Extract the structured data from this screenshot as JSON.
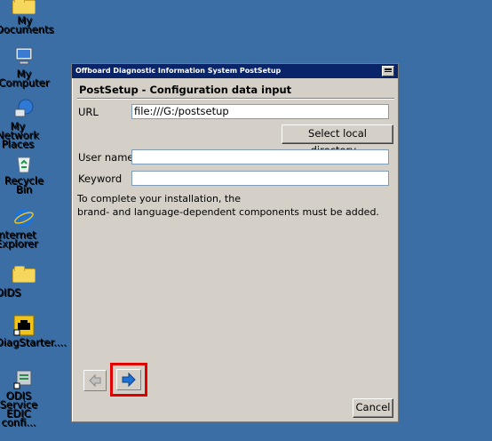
{
  "desktop": {
    "icons": [
      {
        "label": "My Documents",
        "icon": "folder-icon"
      },
      {
        "label": "My Computer",
        "icon": "computer-icon"
      },
      {
        "label": "My Network Places",
        "icon": "network-icon"
      },
      {
        "label": "Recycle Bin",
        "icon": "recycle-bin-icon"
      },
      {
        "label": "Internet Explorer",
        "icon": "internet-explorer-icon"
      },
      {
        "label": "OIDS",
        "icon": "folder-icon"
      },
      {
        "label": "DiagStarter....",
        "icon": "diagstarter-icon"
      },
      {
        "label": "ODIS Service EDIC confi...",
        "icon": "odis-service-icon"
      }
    ]
  },
  "window": {
    "title": "Offboard Diagnostic Information System PostSetup",
    "heading": "PostSetup - Configuration data input",
    "url_label": "URL",
    "url_value": "file:///G:/postsetup",
    "select_dir_label": "Select local directory...",
    "username_label": "User name",
    "username_value": "",
    "keyword_label": "Keyword",
    "keyword_value": "",
    "info_line1": "To complete your installation, the",
    "info_line2": "brand- and language-dependent components must be added.",
    "cancel_label": "Cancel"
  },
  "colors": {
    "desktop": "#3a6ea5",
    "titlebar": "#0a246a",
    "highlight": "#e00000",
    "arrow": "#1e73d8"
  }
}
